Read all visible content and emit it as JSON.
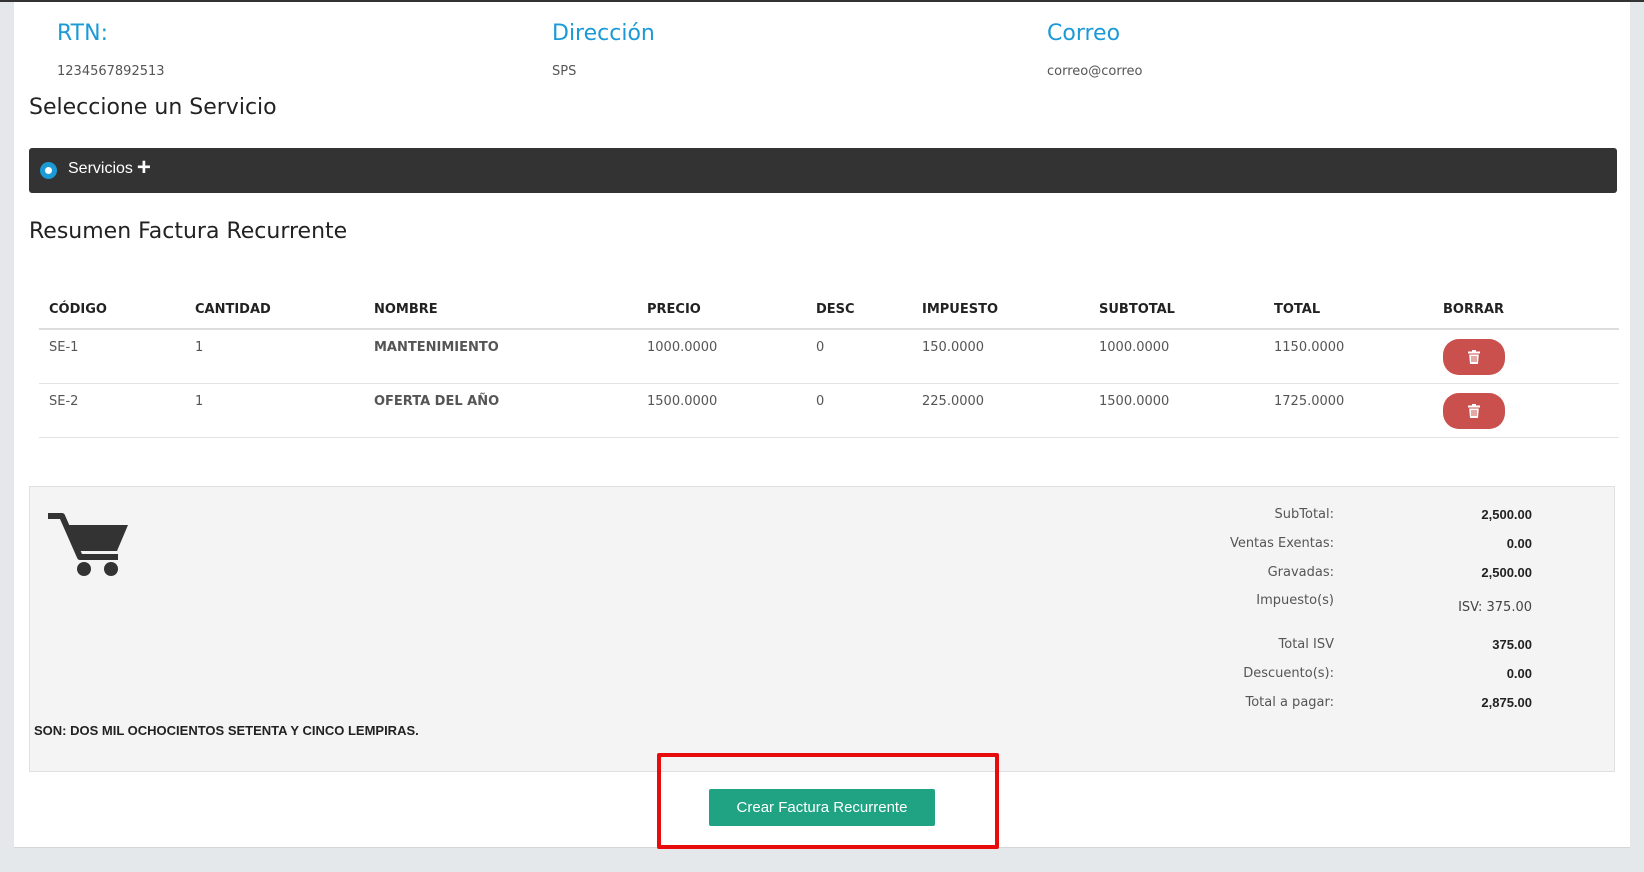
{
  "customer": {
    "rtn_label": "RTN:",
    "rtn_value": "1234567892513",
    "address_label": "Dirección",
    "address_value": "SPS",
    "email_label": "Correo",
    "email_value": "correo@correo"
  },
  "service_section": {
    "title": "Seleccione un Servicio",
    "services_label": "Servicios",
    "add_icon": "plus-icon"
  },
  "summary_section": {
    "title": "Resumen Factura Recurrente"
  },
  "table": {
    "headers": [
      "CÓDIGO",
      "CANTIDAD",
      "NOMBRE",
      "PRECIO",
      "DESC",
      "IMPUESTO",
      "SUBTOTAL",
      "TOTAL",
      "BORRAR"
    ],
    "rows": [
      {
        "codigo": "SE-1",
        "cantidad": "1",
        "nombre": "MANTENIMIENTO",
        "precio": "1000.0000",
        "desc": "0",
        "impuesto": "150.0000",
        "subtotal": "1000.0000",
        "total": "1150.0000"
      },
      {
        "codigo": "SE-2",
        "cantidad": "1",
        "nombre": "OFERTA DEL AÑO",
        "precio": "1500.0000",
        "desc": "0",
        "impuesto": "225.0000",
        "subtotal": "1500.0000",
        "total": "1725.0000"
      }
    ],
    "delete_icon": "trash-icon"
  },
  "totals": {
    "subtotal_label": "SubTotal:",
    "subtotal_value": "2,500.00",
    "exentas_label": "Ventas Exentas:",
    "exentas_value": "0.00",
    "gravadas_label": "Gravadas:",
    "gravadas_value": "2,500.00",
    "impuesto_label": "Impuesto(s)",
    "impuesto_value": "ISV: 375.00",
    "total_isv_label": "Total ISV",
    "total_isv_value": "375.00",
    "descuento_label": "Descuento(s):",
    "descuento_value": "0.00",
    "total_pagar_label": "Total a pagar:",
    "total_pagar_value": "2,875.00",
    "amount_words": "SON: DOS MIL OCHOCIENTOS SETENTA Y CINCO LEMPIRAS."
  },
  "actions": {
    "create_label": "Crear Factura Recurrente"
  },
  "colors": {
    "accent": "#1b9ad6",
    "create_button": "#1fa383",
    "delete_button": "#c9504d",
    "highlight_box": "#e80b0b",
    "service_bar": "#333333",
    "link_value": "#3b3be0"
  }
}
